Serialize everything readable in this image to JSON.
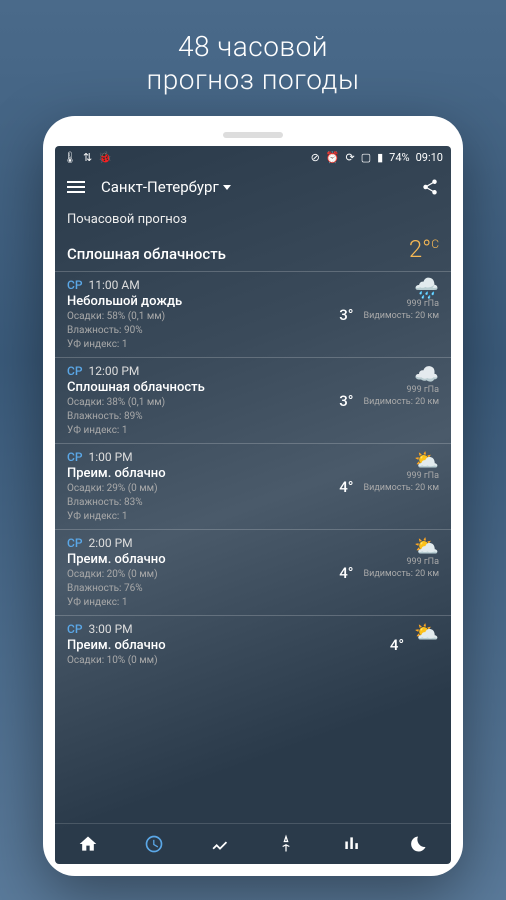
{
  "promo": {
    "line1": "48 часовой",
    "line2": "прогноз погоды"
  },
  "statusbar": {
    "battery": "74%",
    "time": "09:10"
  },
  "appbar": {
    "location": "Санкт-Петербург"
  },
  "section": {
    "title": "Почасовой прогноз"
  },
  "current": {
    "desc": "Сплошная облачность",
    "temp": "2°",
    "unit": "C"
  },
  "labels": {
    "precip": "Осадки:",
    "humidity": "Влажность:",
    "uv": "УФ индекс:",
    "pressure_unit": "гПа",
    "visibility": "Видимость:"
  },
  "hours": [
    {
      "day": "СР",
      "time": "11:00 AM",
      "cond": "Небольшой дождь",
      "precip": "58% (0,1 мм)",
      "humidity": "90%",
      "uv": "1",
      "temp": "3°",
      "pressure": "999",
      "visibility": "20 км",
      "icon": "🌧️"
    },
    {
      "day": "СР",
      "time": "12:00 PM",
      "cond": "Сплошная облачность",
      "precip": "38% (0,1 мм)",
      "humidity": "89%",
      "uv": "1",
      "temp": "3°",
      "pressure": "999",
      "visibility": "20 км",
      "icon": "☁️"
    },
    {
      "day": "СР",
      "time": "1:00 PM",
      "cond": "Преим. облачно",
      "precip": "29% (0 мм)",
      "humidity": "83%",
      "uv": "1",
      "temp": "4°",
      "pressure": "999",
      "visibility": "20 км",
      "icon": "⛅"
    },
    {
      "day": "СР",
      "time": "2:00 PM",
      "cond": "Преим. облачно",
      "precip": "20% (0 мм)",
      "humidity": "76%",
      "uv": "1",
      "temp": "4°",
      "pressure": "999",
      "visibility": "20 км",
      "icon": "⛅"
    },
    {
      "day": "СР",
      "time": "3:00 PM",
      "cond": "Преим. облачно",
      "precip": "10% (0 мм)",
      "humidity": "",
      "uv": "",
      "temp": "4°",
      "pressure": "",
      "visibility": "",
      "icon": "⛅"
    }
  ]
}
